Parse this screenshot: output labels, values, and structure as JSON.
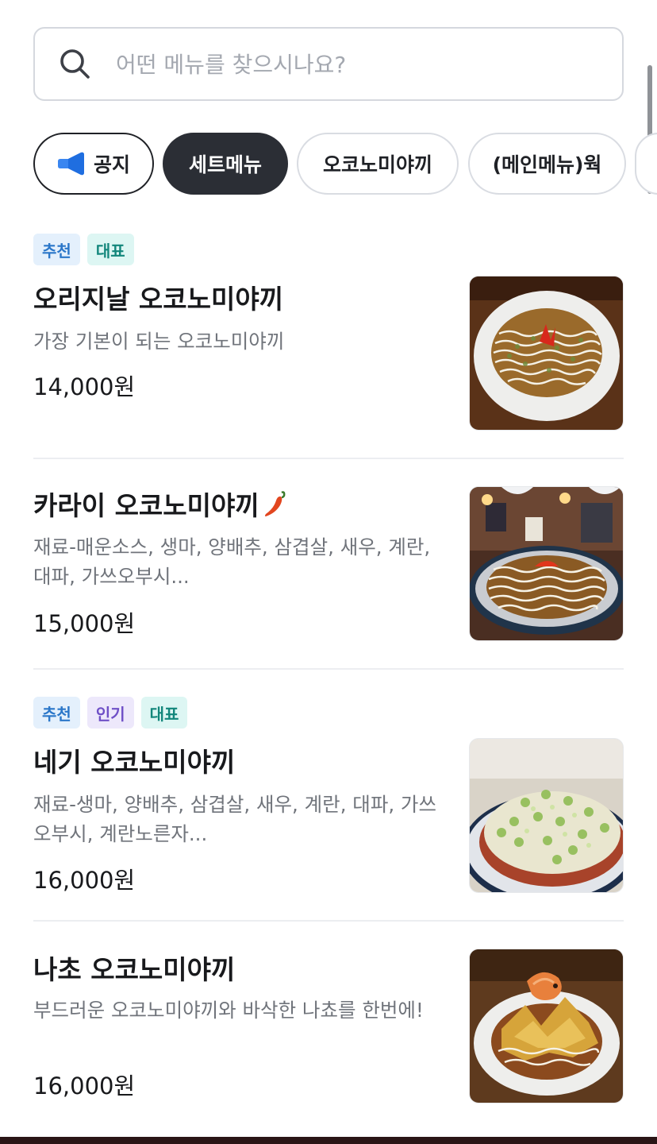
{
  "search": {
    "placeholder": "어떤 메뉴를 찾으시나요?"
  },
  "categories": [
    {
      "label": "공지",
      "icon": "megaphone-icon"
    },
    {
      "label": "세트메뉴",
      "active": true
    },
    {
      "label": "오코노미야끼"
    },
    {
      "label": "(메인메뉴)웍"
    }
  ],
  "menu_items": [
    {
      "tags": [
        "추천",
        "대표"
      ],
      "name": "오리지날 오코노미야끼",
      "description": "가장 기본이 되는 오코노미야끼",
      "price": "14,000원"
    },
    {
      "tags": [],
      "name": "카라이 오코노미야끼",
      "name_icon": "chili-pepper-icon",
      "description": "재료-매운소스, 생마, 양배추, 삼겹살, 새우, 계란, 대파, 가쓰오부시...",
      "price": "15,000원"
    },
    {
      "tags": [
        "추천",
        "인기",
        "대표"
      ],
      "name": "네기 오코노미야끼",
      "description": "재료-생마, 양배추, 삼겹살, 새우, 계란, 대파, 가쓰오부시, 계란노른자...",
      "price": "16,000원"
    },
    {
      "tags": [],
      "name": "나초 오코노미야끼",
      "description": "부드러운 오코노미야끼와 바삭한 나쵸를 한번에!",
      "price": "16,000원"
    }
  ],
  "colors": {
    "active_chip_bg": "#2b2e35",
    "tag_recommend": "#2b77c9",
    "tag_representative": "#12867b",
    "tag_popular": "#6f4fc7",
    "accent_blue": "#3a86f0"
  }
}
